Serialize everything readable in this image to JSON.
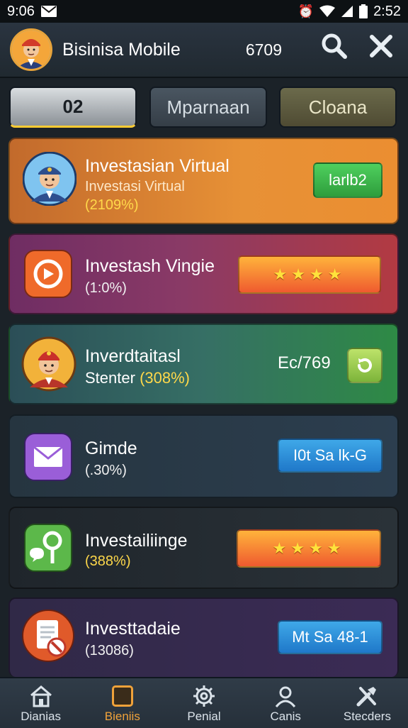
{
  "status_bar": {
    "time": "9:06",
    "clock": "2:52"
  },
  "header": {
    "title": "Bisinisa Mobile",
    "balance": "6709"
  },
  "tabs": [
    {
      "label": "02"
    },
    {
      "label": "Mparnaan"
    },
    {
      "label": "Cloana"
    }
  ],
  "cards": [
    {
      "title": "Investasian Virtual",
      "subtitle": "Investasi Virtual",
      "percent": "(2109%)",
      "button": "larlb2"
    },
    {
      "title": "Investash Vingie",
      "percent": "(1:0%)",
      "rating": "★★★★"
    },
    {
      "title": "Inverdtaitasl",
      "subtitle": "Stenter",
      "percent": "(308%)",
      "value": "Ec/769"
    },
    {
      "title": "Gimde",
      "percent": "(.30%)",
      "button": "I0t Sa lk-G"
    },
    {
      "title": "Investailiinge",
      "percent": "(388%)",
      "rating": "★★★★"
    },
    {
      "title": "Investtadaie",
      "percent": "(13086)",
      "button": "Mt Sa 48-1"
    }
  ],
  "bottom_nav": [
    {
      "label": "Dianias",
      "icon": "home-icon"
    },
    {
      "label": "Bieniis",
      "icon": "box-icon"
    },
    {
      "label": "Penial",
      "icon": "gear-icon"
    },
    {
      "label": "Canis",
      "icon": "user-icon"
    },
    {
      "label": "Stecders",
      "icon": "tools-icon"
    }
  ],
  "colors": {
    "accent": "#f0a23a",
    "highlight": "#ffd84a"
  }
}
